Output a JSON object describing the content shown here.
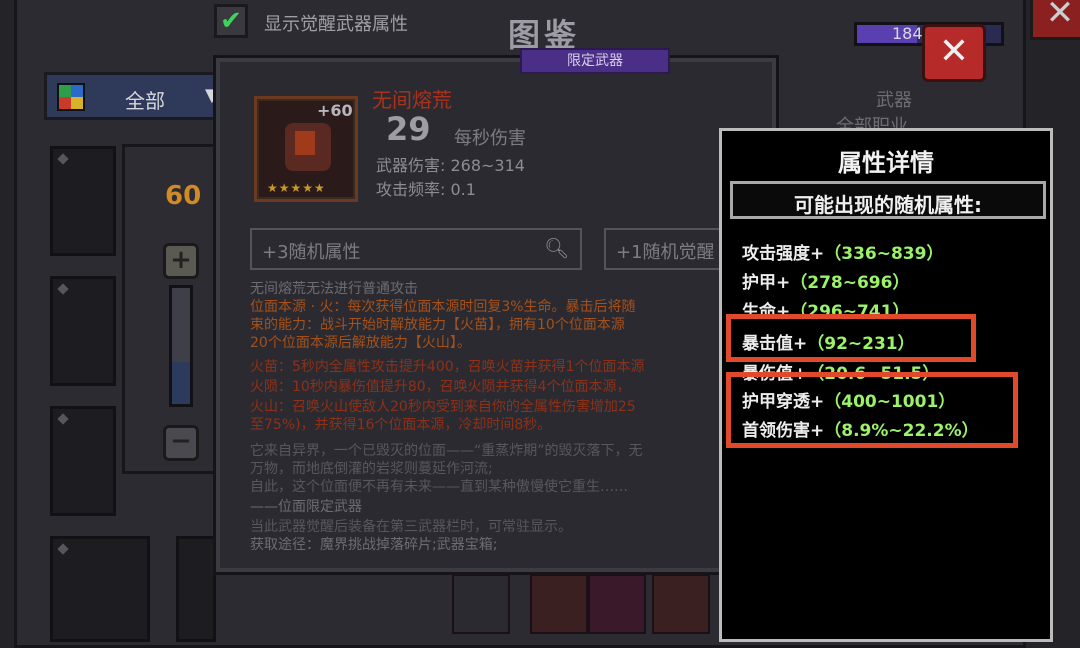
{
  "top_bar": {
    "checkbox_mark": "✔",
    "checkbox_label": "显示觉醒武器属性",
    "title": "图鉴",
    "currency_text": "184",
    "close_symbol": "✕"
  },
  "filter": {
    "label": "全部",
    "arrow": "▼"
  },
  "slider": {
    "level": "60",
    "plus": "+",
    "minus": "−",
    "fill_fraction": 0.35
  },
  "weapon": {
    "badge": "限定武器",
    "plus_level": "+60",
    "stars": "★★★★★",
    "name": "无间熔荒",
    "dps_value": "29",
    "dps_label": "每秒伤害",
    "damage_stat": "武器伤害: 268~314",
    "frequency_stat": "攻击频率: 0.1",
    "type": "武器",
    "class": "全部职业",
    "random_attr_box": "+3随机属性",
    "random_awaken_box": "+1随机觉醒"
  },
  "description": {
    "line1": "无间熔荒无法进行普通攻击",
    "line2": "位面本源 · 火：每次获得位面本源时回复3%生命。暴击后将随",
    "line3": "束的能力：战斗开始时解放能力【火苗】，拥有10个位面本源",
    "line4": "20个位面本源后解放能力【火山】。",
    "line5": "火苗：5秒内全属性攻击提升400，召唤火苗并获得1个位面本源",
    "line6": "火陨：10秒内暴伤值提升80，召唤火陨并获得4个位面本源，",
    "line7": "火山：召唤火山使敌人20秒内受到来自你的全属性伤害增加25",
    "line8": "至75%)，并获得16个位面本源，冷却时间8秒。",
    "line9": "它来自异界，一个已毁灭的位面——“重蒸炸期”的毁灭落下，无",
    "line10": "万物，而地底倒灌的岩浆则蔓延作河流;",
    "line11": "自此，这个位面便不再有未来——直到某种傲慢使它重生……",
    "line12": "——位面限定武器",
    "line13": "当此武器觉醒后装备在第三武器栏时，可常驻显示。",
    "line14": "获取途径：魔界挑战掉落碎片;武器宝箱;"
  },
  "attributes_popup": {
    "title": "属性详情",
    "subtitle": "可能出现的随机属性:",
    "items": [
      {
        "name": "攻击强度+",
        "range": "（336~839）"
      },
      {
        "name": "护甲+",
        "range": "（278~696）"
      },
      {
        "name": "生命+",
        "range": "（296~741）"
      },
      {
        "name": "暴击值+",
        "range": "（92~231）"
      },
      {
        "name": "暴伤值+",
        "range": "（20.6~51.5）"
      },
      {
        "name": "护甲穿透+",
        "range": "（400~1001）"
      },
      {
        "name": "首领伤害+",
        "range": "（8.9%~22.2%）"
      }
    ]
  },
  "colors": {
    "highlight": "#e04a2a",
    "range_text": "#9bf26b",
    "weapon_name": "#a8321c"
  }
}
